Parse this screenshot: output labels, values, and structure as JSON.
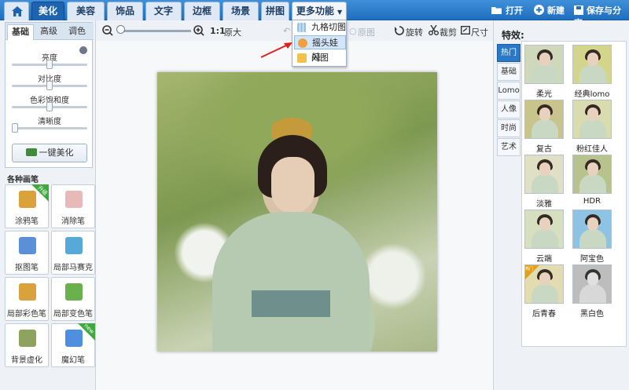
{
  "top_nav": {
    "tabs": [
      "美化",
      "美容",
      "饰品",
      "文字",
      "边框",
      "场景",
      "拼图"
    ],
    "more_label": "更多功能",
    "open_label": "打开",
    "new_label": "新建",
    "save_label": "保存与分享"
  },
  "left_panel": {
    "subtabs": [
      "基础",
      "高级",
      "调色"
    ],
    "sliders": [
      {
        "label": "亮度",
        "value": 0.5
      },
      {
        "label": "对比度",
        "value": 0.5
      },
      {
        "label": "色彩饱和度",
        "value": 0.5
      },
      {
        "label": "清晰度",
        "value": 0
      }
    ],
    "one_click_label": "一键美化",
    "brush_title": "各种画笔",
    "brushes": [
      {
        "label": "涂鸦笔",
        "badge": "升级"
      },
      {
        "label": "消除笔",
        "badge": ""
      },
      {
        "label": "抠图笔",
        "badge": ""
      },
      {
        "label": "局部马赛克",
        "badge": ""
      },
      {
        "label": "局部彩色笔",
        "badge": ""
      },
      {
        "label": "局部变色笔",
        "badge": ""
      },
      {
        "label": "背景虚化",
        "badge": ""
      },
      {
        "label": "魔幻笔",
        "badge": "new"
      }
    ]
  },
  "toolbar": {
    "ratio_label": "1:1",
    "original_label": "原大",
    "restore_label": "原图",
    "rotate_label": "旋转",
    "crop_label": "裁剪",
    "size_label": "尺寸"
  },
  "more_menu": {
    "items": [
      "九格切图",
      "摇头娃娃",
      "闪图"
    ]
  },
  "right_panel": {
    "title": "特效:",
    "categories": [
      "热门",
      "基础",
      "Lomo",
      "人像",
      "时尚",
      "艺术"
    ],
    "effects": [
      "柔光",
      "经典lomo",
      "复古",
      "粉红佳人",
      "淡雅",
      "HDR",
      "云端",
      "阿宝色",
      "后青春",
      "黑白色"
    ],
    "hot_badge": "热门"
  },
  "colors": {
    "nav_blue": "#1f6fc0",
    "active_tab": "#1d63b0",
    "arrow_red": "#e02020",
    "badge_green": "#3fa83f"
  }
}
